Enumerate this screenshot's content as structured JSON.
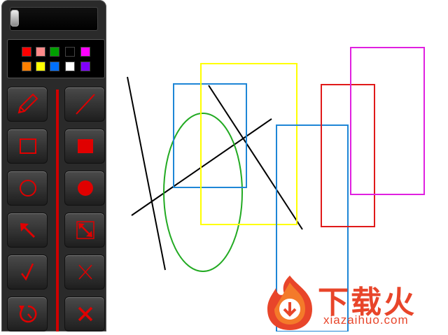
{
  "toolbar": {
    "colors": [
      "#ff0000",
      "#ff8a8a",
      "#00a000",
      "#000000",
      "#ff00ff",
      "#ff8000",
      "#ffff00",
      "#0070ff",
      "#ffffff",
      "#8000ff"
    ],
    "tool_color": "#e00000",
    "tools": [
      {
        "name": "pencil-tool",
        "icon": "pencil-icon"
      },
      {
        "name": "line-tool",
        "icon": "line-icon"
      },
      {
        "name": "rectangle-outline-tool",
        "icon": "square-outline-icon"
      },
      {
        "name": "rectangle-filled-tool",
        "icon": "square-filled-icon"
      },
      {
        "name": "ellipse-outline-tool",
        "icon": "circle-outline-icon"
      },
      {
        "name": "ellipse-filled-tool",
        "icon": "circle-filled-icon"
      },
      {
        "name": "arrow-tool",
        "icon": "arrow-up-left-icon"
      },
      {
        "name": "resize-tool",
        "icon": "resize-arrows-icon"
      },
      {
        "name": "check-tool",
        "icon": "checkmark-icon"
      },
      {
        "name": "cross-tool",
        "icon": "cross-icon"
      },
      {
        "name": "undo-tool",
        "icon": "undo-icon"
      },
      {
        "name": "clear-tool",
        "icon": "close-icon"
      }
    ]
  },
  "canvas": {
    "colors": {
      "black": "#000000",
      "blue": "#1e86d6",
      "yellow": "#ffff00",
      "green": "#22aa22",
      "red": "#e01a1a",
      "magenta": "#e020e0"
    }
  },
  "watermark": {
    "brand_cn": "下载火",
    "url": "xiazaihuo.com",
    "color": "#e8452a"
  }
}
